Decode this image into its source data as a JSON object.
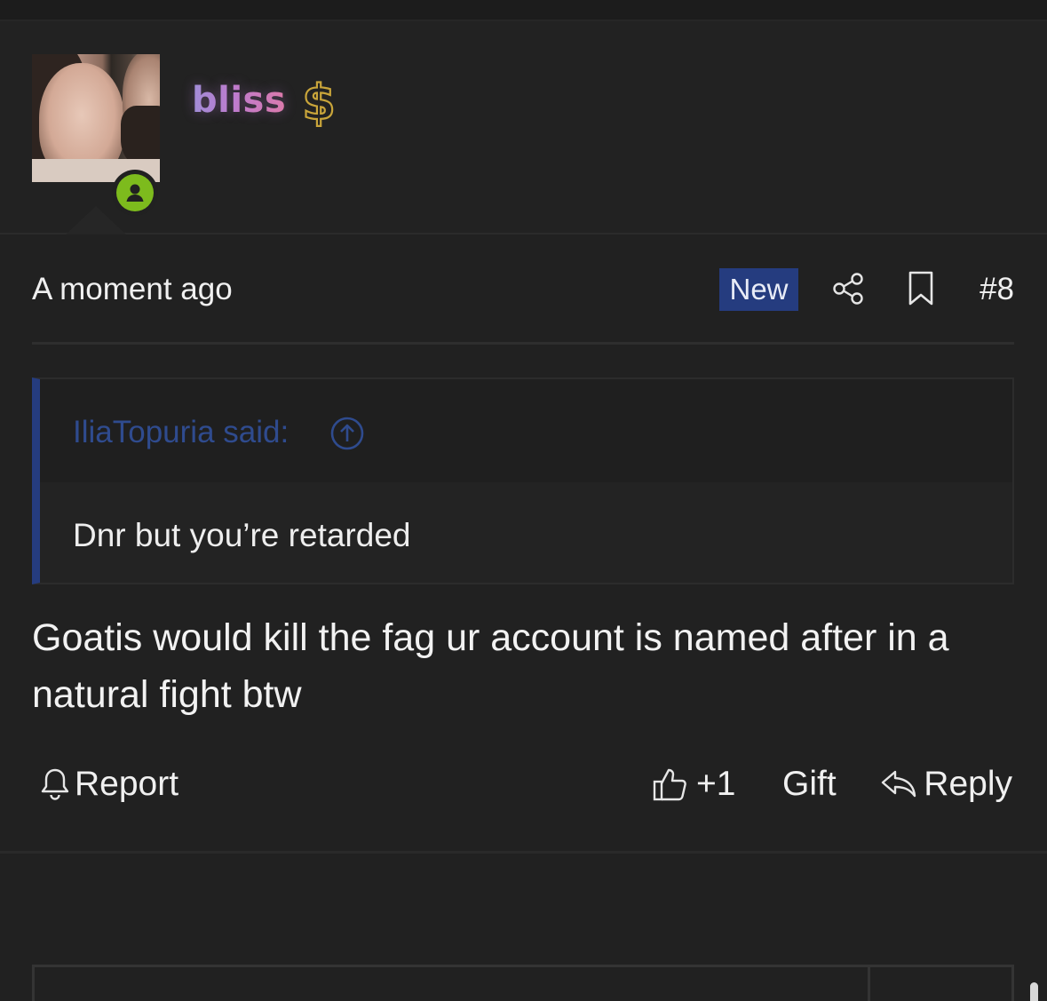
{
  "user": {
    "name": "bliss",
    "online_status": "online",
    "badge_icon": "dollar-sign-icon"
  },
  "post": {
    "timestamp": "A moment ago",
    "new_badge": "New",
    "number": "#8",
    "quote": {
      "author_line": "IliaTopuria said:",
      "text": "Dnr but you’re retarded"
    },
    "body": "Goatis would kill the fag ur account is named after in a natural fight btw"
  },
  "actions": {
    "report": "Report",
    "like_count": "+1",
    "gift": "Gift",
    "reply": "Reply"
  },
  "colors": {
    "background": "#212121",
    "accent_blue": "#253c7f",
    "online_green": "#7dbb1d",
    "username_gradient": [
      "#9c8fd6",
      "#c07ccd",
      "#e07aa4"
    ],
    "dollar_gold": "#c9a53a"
  }
}
